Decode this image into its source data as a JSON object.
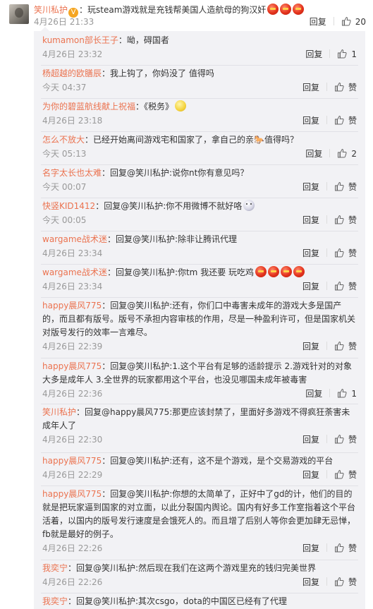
{
  "main_post": {
    "user": "笑川私护",
    "text": "：玩steam游戏就是充钱帮美国人造航母的狗汉奸",
    "time": "4月26日 21:33",
    "reply_label": "回复",
    "like_count": "20",
    "emojis": [
      "red",
      "red",
      "red"
    ]
  },
  "replies": [
    {
      "user": "kumamon部长王子",
      "text": "：呦，碍国者",
      "time": "4月26日 23:32",
      "reply_label": "回复",
      "like_label": "1",
      "emojis": []
    },
    {
      "user": "杨超越的欧膳辰",
      "text": "：我上钩了，你妈没了 值得吗",
      "time": "今天 04:37",
      "reply_label": "回复",
      "like_label": "赞",
      "emojis": []
    },
    {
      "user": "为你的碧蓝航线献上祝福",
      "text": "：《税务》",
      "time": "4月26日 23:18",
      "reply_label": "回复",
      "like_label": "赞",
      "emojis": [
        "yellow"
      ]
    },
    {
      "user": "怎么不放大",
      "text": "：已经开始离间游戏宅和国家了，拿自己的亲🐎值得吗？",
      "time": "今天 05:13",
      "reply_label": "回复",
      "like_label": "2",
      "emojis": []
    },
    {
      "user": "名字太长也太难",
      "text": "：回复@笑川私护:说你nt你有意见吗？",
      "time": "今天 00:07",
      "reply_label": "回复",
      "like_label": "赞",
      "emojis": []
    },
    {
      "user": "快竖KID1412",
      "text": "：回复@笑川私护:你不用微博不就好咯",
      "time": "今天 00:05",
      "reply_label": "回复",
      "like_label": "赞",
      "emojis": [
        "face"
      ]
    },
    {
      "user": "wargame战术迷",
      "text": "：回复@笑川私护:除非让腾讯代理",
      "time": "4月26日 23:34",
      "reply_label": "回复",
      "like_label": "赞",
      "emojis": []
    },
    {
      "user": "wargame战术迷",
      "text": "：回复@笑川私护:你tm 我还要 玩吃鸡",
      "time": "4月26日 23:34",
      "reply_label": "回复",
      "like_label": "赞",
      "emojis": [
        "red",
        "red",
        "red",
        "red"
      ]
    },
    {
      "user": "happy晨风775",
      "text": "：回复@笑川私护:还有，你们口中毒害未成年的游戏大多是国产的，而且都有版号。版号不承担内容审核的作用，尽是一种盈利许可，但是国家机关对版号发行的效率一言难尽。",
      "time": "4月26日 22:39",
      "reply_label": "回复",
      "like_label": "赞",
      "emojis": []
    },
    {
      "user": "happy晨风775",
      "text": "：回复@笑川私护:1.这个平台有足够的适龄提示 2.游戏针对的对象大多是成年人 3.全世界的玩家都用这个平台，也没见哪国未成年被毒害",
      "time": "4月26日 22:36",
      "reply_label": "回复",
      "like_label": "1",
      "emojis": []
    },
    {
      "user": "笑川私护",
      "text": "：回复@happy晨风775:那更应该封禁了，里面好多游戏不得疯狂荼害未成年人了",
      "time": "4月26日 22:30",
      "reply_label": "回复",
      "like_label": "赞",
      "emojis": []
    },
    {
      "user": "happy晨风775",
      "text": "：回复@笑川私护:还有，这不是个游戏，是个交易游戏的平台",
      "time": "4月26日 22:29",
      "reply_label": "回复",
      "like_label": "赞",
      "emojis": []
    },
    {
      "user": "happy晨风775",
      "text": "：回复@笑川私护:你想的太简单了，正好中了gd的计，他们的目的就是把玩家逼到国家的对立面，以此分裂国内舆论。国内有好多工作室指着这个平台活着，以国内的版号发行速度是会饿死人的。而且增了后别人等你会更加肆无忌惮，fb就是最好的例子。",
      "time": "4月26日 22:26",
      "reply_label": "回复",
      "like_label": "赞",
      "emojis": []
    },
    {
      "user": "我奕宁",
      "text": "：回复@笑川私护:然后现在我们在这两个游戏里充的钱归完美世界",
      "time": "4月26日 22:26",
      "reply_label": "回复",
      "like_label": "赞",
      "emojis": []
    },
    {
      "user": "我奕宁",
      "text": "：回复@笑川私护:其次csgo，dota的中国区已经有了代理",
      "time": "",
      "reply_label": "",
      "like_label": "",
      "emojis": []
    }
  ]
}
